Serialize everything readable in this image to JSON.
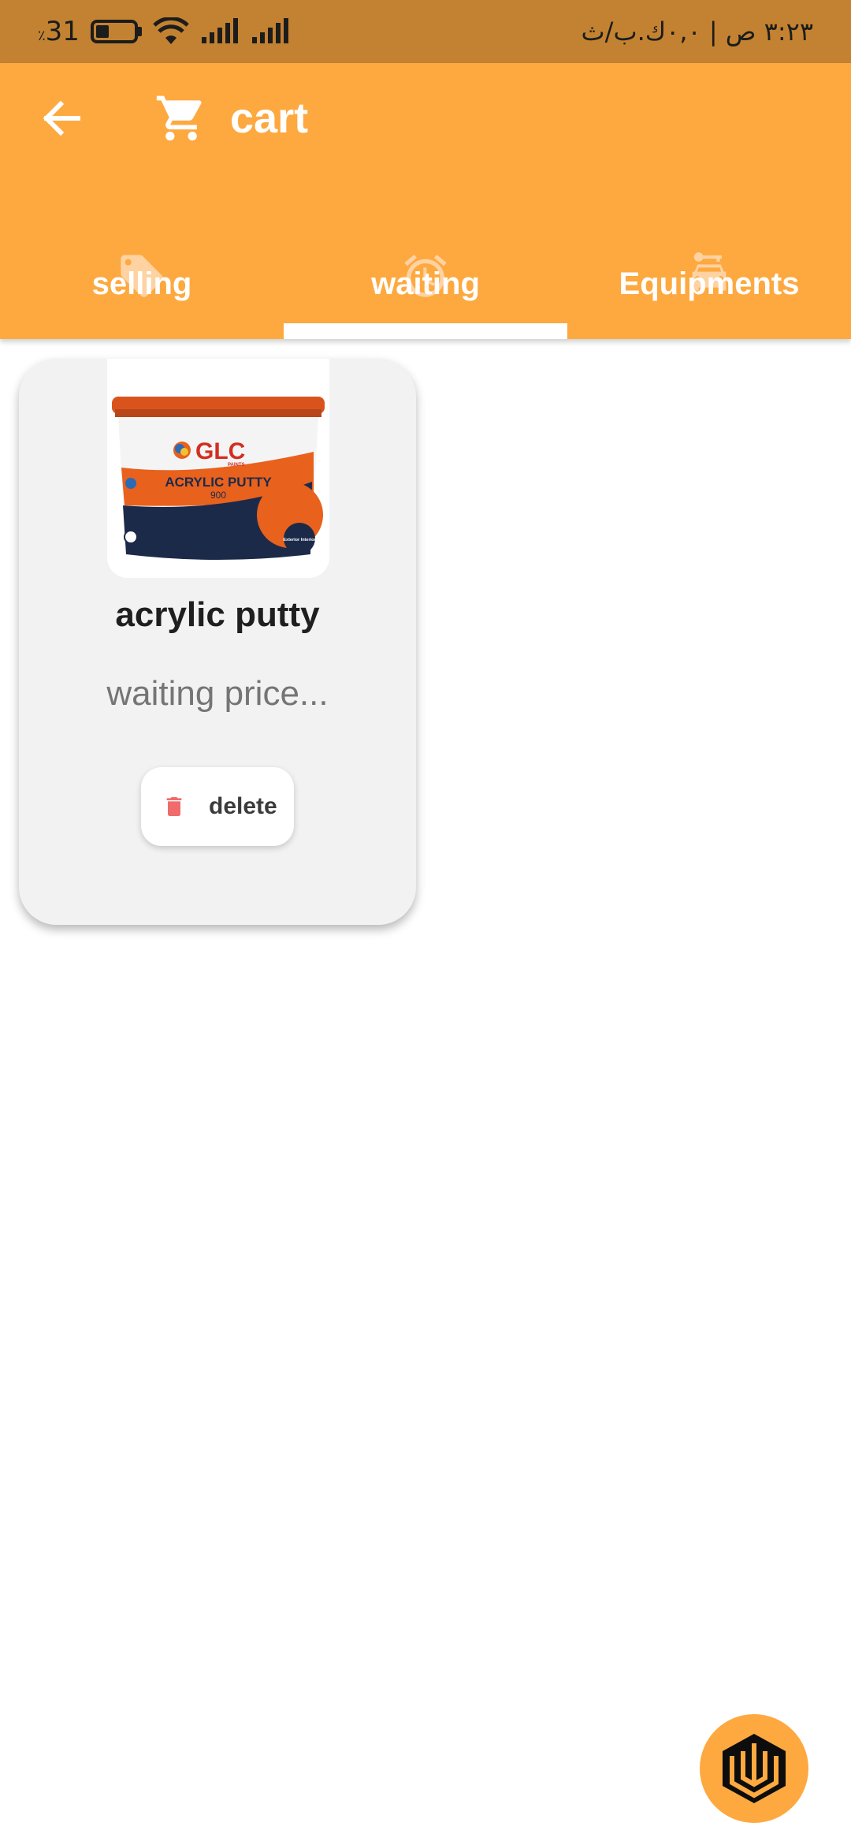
{
  "status_bar": {
    "battery_text": "31",
    "battery_unit": "٪",
    "time_text": "٣:٢٣ ص | ٠,٠ك.ب/ث"
  },
  "app_bar": {
    "title": "cart",
    "background_color": "#fda940"
  },
  "tabs": [
    {
      "label": "selling",
      "icon": "tag-icon"
    },
    {
      "label": "waiting",
      "icon": "alarm-clock-icon",
      "selected": true
    },
    {
      "label": "Equipments",
      "icon": "car-key-icon"
    }
  ],
  "products": [
    {
      "image_brand": "GLC",
      "image_brand_sub": "PAINTS",
      "image_product": "ACRYLIC PUTTY",
      "image_code": "900",
      "image_tag": "Exterior Interior",
      "name": "acrylic putty",
      "price_status": "waiting price...",
      "delete_label": "delete"
    }
  ],
  "fab": {
    "icon": "brand-logo-icon"
  }
}
